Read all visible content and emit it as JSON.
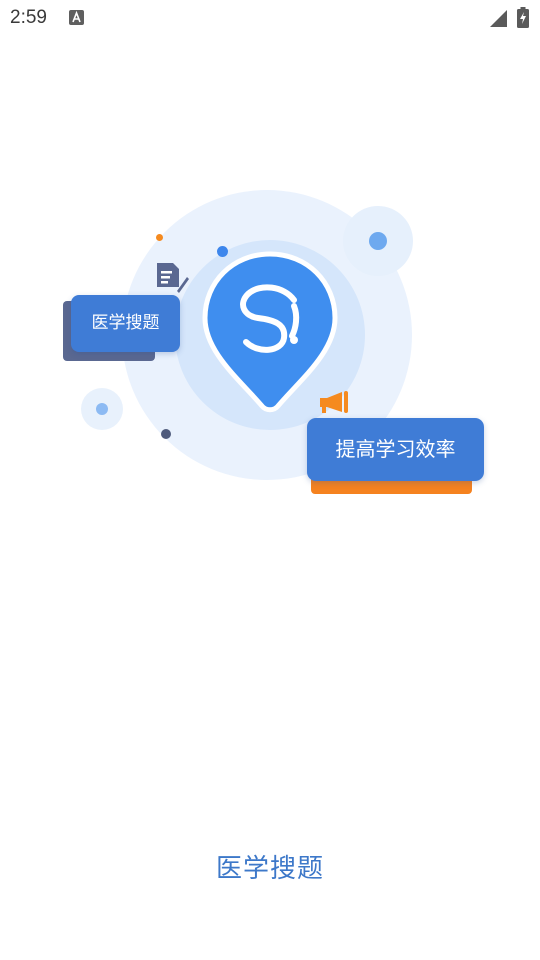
{
  "status_bar": {
    "time": "2:59",
    "icons": [
      "notification-a-icon",
      "signal-icon",
      "battery-charging-icon"
    ]
  },
  "illustration": {
    "tag_left": "医学搜题",
    "tag_right": "提高学习效率",
    "icons": [
      "map-pin-logo-icon",
      "document-edit-icon",
      "megaphone-icon"
    ]
  },
  "footer": {
    "app_name": "医学搜题"
  },
  "colors": {
    "brand_blue": "#3f7cd6",
    "accent_orange": "#f5821f",
    "app_name_text": "#3d78c9"
  }
}
